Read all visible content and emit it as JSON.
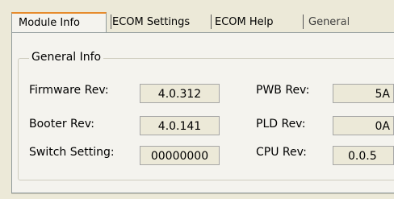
{
  "tabs": [
    {
      "label": "Module Info",
      "active": true
    },
    {
      "label": "ECOM Settings",
      "active": false
    },
    {
      "label": "ECOM Help",
      "active": false
    },
    {
      "label": "General",
      "active": false
    }
  ],
  "group": {
    "title": "General Info",
    "fields": {
      "firmware_rev": {
        "label": "Firmware Rev:",
        "value": "4.0.312"
      },
      "booter_rev": {
        "label": "Booter Rev:",
        "value": "4.0.141"
      },
      "switch_setting": {
        "label": "Switch Setting:",
        "value": "00000000"
      },
      "pwb_rev": {
        "label": "PWB Rev:",
        "value": "5A"
      },
      "pld_rev": {
        "label": "PLD Rev:",
        "value": "0A"
      },
      "cpu_rev": {
        "label": "CPU Rev:",
        "value": "0.0.5"
      }
    }
  }
}
